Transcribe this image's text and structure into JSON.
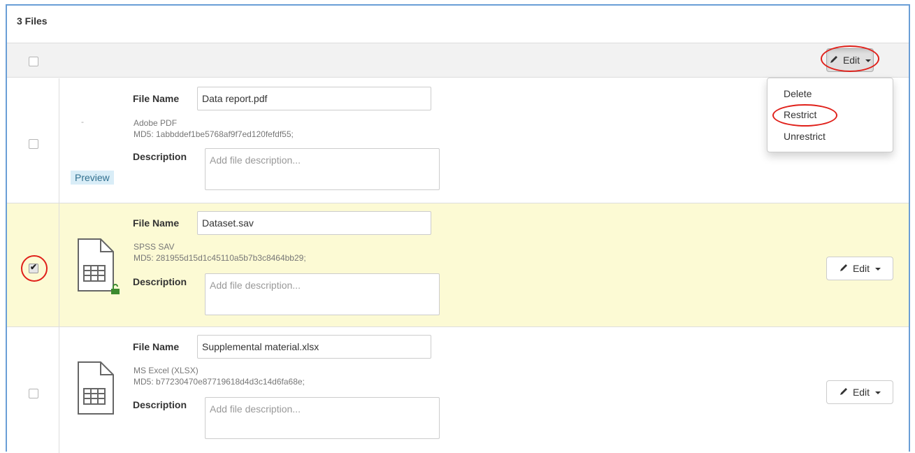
{
  "header": {
    "files_count": "3 Files"
  },
  "edit_button": {
    "label": "Edit"
  },
  "dropdown": {
    "items": [
      "Delete",
      "Restrict",
      "Unrestrict"
    ]
  },
  "labels": {
    "file_name": "File Name",
    "description": "Description",
    "preview": "Preview"
  },
  "files": [
    {
      "name": "Data report.pdf",
      "type": "Adobe PDF",
      "md5": "MD5: 1abbddef1be5768af9f7ed120fefdf55;",
      "description_placeholder": "Add file description...",
      "checked": false,
      "thumbnail": "dash"
    },
    {
      "name": "Dataset.sav",
      "type": "SPSS SAV",
      "md5": "MD5: 281955d15d1c45110a5b7b3c8464bb29;",
      "description_placeholder": "Add file description...",
      "checked": true,
      "thumbnail": "table-file-icon",
      "unlocked": true
    },
    {
      "name": "Supplemental material.xlsx",
      "type": "MS Excel (XLSX)",
      "md5": "MD5: b77230470e87719618d4d3c14d6fa68e;",
      "description_placeholder": "Add file description...",
      "checked": false,
      "thumbnail": "table-file-icon"
    }
  ],
  "colors": {
    "highlight_oval": "#e0201a",
    "selected_row": "#fcfad4",
    "frame_border": "#6a9ed6",
    "unlock_icon": "#3c8a2e"
  }
}
